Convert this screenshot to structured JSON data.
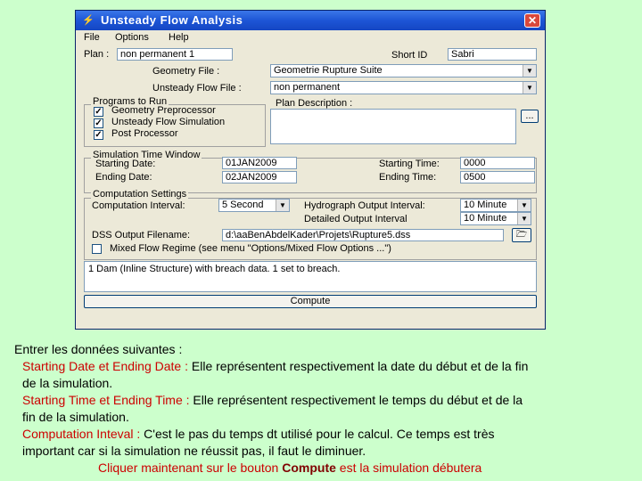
{
  "window": {
    "title": "Unsteady Flow Analysis",
    "icon": "app-icon",
    "close_label": "✕"
  },
  "menu": [
    "File",
    "Options",
    "Help"
  ],
  "plan": {
    "label": "Plan :",
    "value": "non permanent 1",
    "short_id_label": "Short ID",
    "short_id_value": "Sabri"
  },
  "geometry_file": {
    "label": "Geometry File :",
    "value": "Geometrie Rupture Suite"
  },
  "unsteady_flow_file": {
    "label": "Unsteady Flow File :",
    "value": "non permanent"
  },
  "programs": {
    "title": "Programs to Run",
    "items": [
      {
        "label": "Geometry Preprocessor",
        "checked": true
      },
      {
        "label": "Unsteady Flow Simulation",
        "checked": true
      },
      {
        "label": "Post Processor",
        "checked": true
      }
    ]
  },
  "plan_description": {
    "label": "Plan Description :",
    "button_label": "..."
  },
  "sim_window": {
    "title": "Simulation Time Window",
    "starting_date_label": "Starting Date:",
    "starting_date": "01JAN2009",
    "ending_date_label": "Ending Date:",
    "ending_date": "02JAN2009",
    "starting_time_label": "Starting Time:",
    "starting_time": "0000",
    "ending_time_label": "Ending Time:",
    "ending_time": "0500"
  },
  "computation": {
    "title": "Computation Settings",
    "interval_label": "Computation Interval:",
    "interval_value": "5 Second",
    "hydrograph_label": "Hydrograph Output Interval:",
    "hydrograph_value": "10 Minute",
    "detailed_label": "Detailed Output Interval",
    "detailed_value": "10 Minute",
    "dss_label": "DSS Output Filename:",
    "dss_value": "d:\\aaBenAbdelKader\\Projets\\Rupture5.dss",
    "mixed_flow_label": "Mixed Flow Regime (see menu \"Options/Mixed Flow Options ...\")",
    "mixed_flow_checked": false
  },
  "status_text": "1 Dam (Inline Structure) with breach data. 1 set to breach.",
  "compute_label": "Compute",
  "caption": {
    "intro": "Entrer les données suivantes :",
    "l1_term": "Starting Date  et Ending Date :",
    "l1_text": " Elle représentent respectivement la date du début et de la fin",
    "l1b": "de la simulation.",
    "l2_term": "Starting Time  et Ending Time :",
    "l2_text": " Elle représentent respectivement le temps du début et de la",
    "l2b": "fin de la simulation.",
    "l3_term": "Computation Inteval :",
    "l3_text": " C'est le pas du temps dt utilisé pour le calcul. Ce temps est très",
    "l3b": "important car si la simulation ne réussit pas, il faut le diminuer.",
    "l4_pre": "Cliquer maintenant sur le bouton ",
    "l4_bold": "Compute",
    "l4_post": " est la simulation débutera"
  },
  "colors": {
    "background": "#ccffcc",
    "caption_highlight": "#cc0000",
    "titlebar": "#1d55d6"
  }
}
